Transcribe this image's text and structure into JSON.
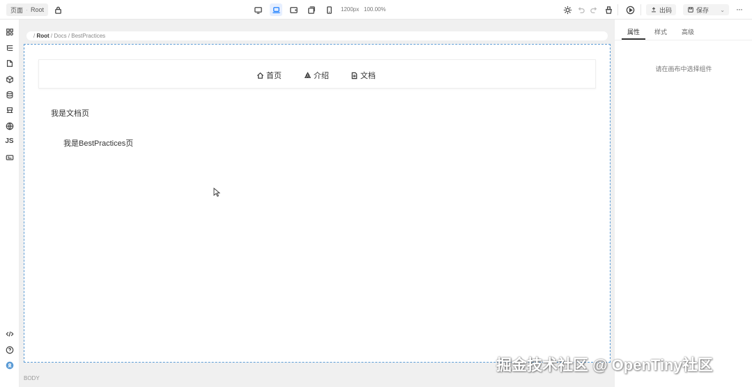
{
  "topbar": {
    "page_tag": "页面",
    "root_tag": "Root",
    "width_readout": "1200px",
    "zoom_readout": "100.00%",
    "publish_label": "出码",
    "save_label": "保存"
  },
  "breadcrumb": {
    "sep": "/",
    "root": "Root",
    "path": "/ Docs / BestPractices"
  },
  "canvas": {
    "nav_items": [
      {
        "label": "首页",
        "icon": "home-icon"
      },
      {
        "label": "介绍",
        "icon": "recycle-icon"
      },
      {
        "label": "文档",
        "icon": "document-icon"
      }
    ],
    "text_docs": "我是文档页",
    "text_best": "我是BestPractices页"
  },
  "status": {
    "body_label": "BODY"
  },
  "right_panel": {
    "tabs": [
      "属性",
      "样式",
      "高级"
    ],
    "empty_hint": "请在画布中选择组件"
  },
  "watermark": "掘金技术社区 @ OpenTiny社区",
  "colors": {
    "accent": "#5b9bd5",
    "active_icon": "#1e80ff"
  }
}
